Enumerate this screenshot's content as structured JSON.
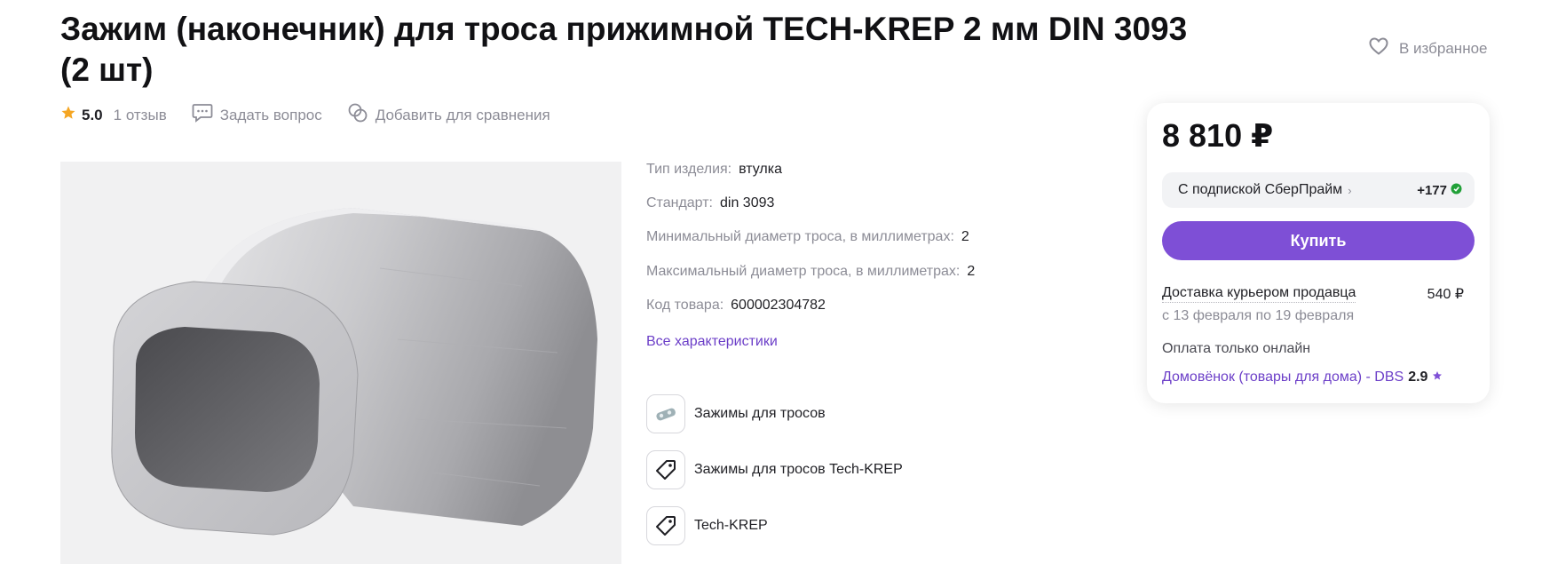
{
  "product": {
    "title": "Зажим (наконечник) для троса прижимной TECH-KREP 2 мм DIN 3093 (2 шт)"
  },
  "favorite": {
    "label": "В избранное",
    "icon": "heart-icon"
  },
  "meta": {
    "rating": "5.0",
    "reviews": "1 отзыв",
    "ask": "Задать вопрос",
    "compare": "Добавить для сравнения"
  },
  "specs": [
    {
      "key": "Тип изделия:",
      "value": "втулка"
    },
    {
      "key": "Стандарт:",
      "value": "din 3093"
    },
    {
      "key": "Минимальный диаметр троса, в миллиметрах:",
      "value": "2"
    },
    {
      "key": "Максимальный диаметр троса, в миллиметрах:",
      "value": "2"
    },
    {
      "key": "Код товара:",
      "value": "600002304782"
    }
  ],
  "all_characteristics": "Все характеристики",
  "categories": [
    {
      "name": "Зажимы для тросов",
      "icon": "cable-clamp-icon"
    },
    {
      "name": "Зажимы для тросов Tech-KREP",
      "icon": "tag-icon"
    },
    {
      "name": "Tech-KREP",
      "icon": "tag-icon"
    }
  ],
  "buybox": {
    "price": "8 810 ₽",
    "sber_label": "С подпиской СберПрайм",
    "sber_bonus": "+177",
    "buy_label": "Купить",
    "delivery_title": "Доставка курьером продавца",
    "delivery_price": "540 ₽",
    "delivery_dates": "с 13 февраля по 19 февраля",
    "payment": "Оплата только онлайн",
    "seller": "Домовёнок (товары для дома) - DBS",
    "seller_rating": "2.9"
  },
  "colors": {
    "accent": "#7e4fd6",
    "link": "#6c3fc8",
    "star": "#f5a623",
    "bonus": "#21a038"
  }
}
